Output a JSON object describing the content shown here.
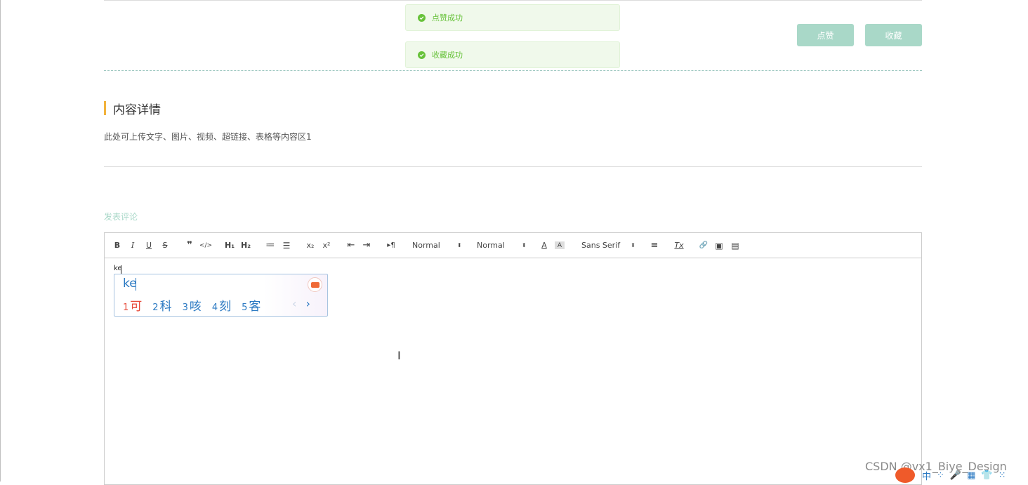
{
  "toasts": [
    {
      "text": "点赞成功"
    },
    {
      "text": "收藏成功"
    }
  ],
  "actions": {
    "like_label": "点赞",
    "favorite_label": "收藏"
  },
  "section": {
    "title": "内容详情",
    "description": "此处可上传文字、图片、视频、超链接、表格等内容区1"
  },
  "comment": {
    "label": "发表评论"
  },
  "toolbar": {
    "bold": "B",
    "italic": "I",
    "underline": "U",
    "strike": "S",
    "blockquote": "❞",
    "code": "</>",
    "h1": "H₁",
    "h2": "H₂",
    "ordered_list": "≔",
    "bullet_list": "☰",
    "subscript": "x₂",
    "superscript": "x²",
    "outdent": "⇤",
    "indent": "⇥",
    "direction": "▸¶",
    "size_value": "Normal",
    "header_value": "Normal",
    "font_color": "A",
    "background_color": "A",
    "font_value": "Sans Serif",
    "align": "≡",
    "clean": "Tx",
    "link": "🔗",
    "image": "▣",
    "video": "▤",
    "dropdown_arrow": "⬍"
  },
  "editor": {
    "typed_text": "ke"
  },
  "ime": {
    "input": "ke",
    "candidates": [
      {
        "num": "1",
        "char": "可"
      },
      {
        "num": "2",
        "char": "科"
      },
      {
        "num": "3",
        "char": "咳"
      },
      {
        "num": "4",
        "char": "刻"
      },
      {
        "num": "5",
        "char": "客"
      }
    ],
    "prev": "‹",
    "next": "›"
  },
  "watermark": "CSDN @vx1_Biye_Design",
  "tray": {
    "items": [
      "中",
      "⁘",
      "🎤",
      "▦",
      "👕",
      "⁙"
    ]
  }
}
